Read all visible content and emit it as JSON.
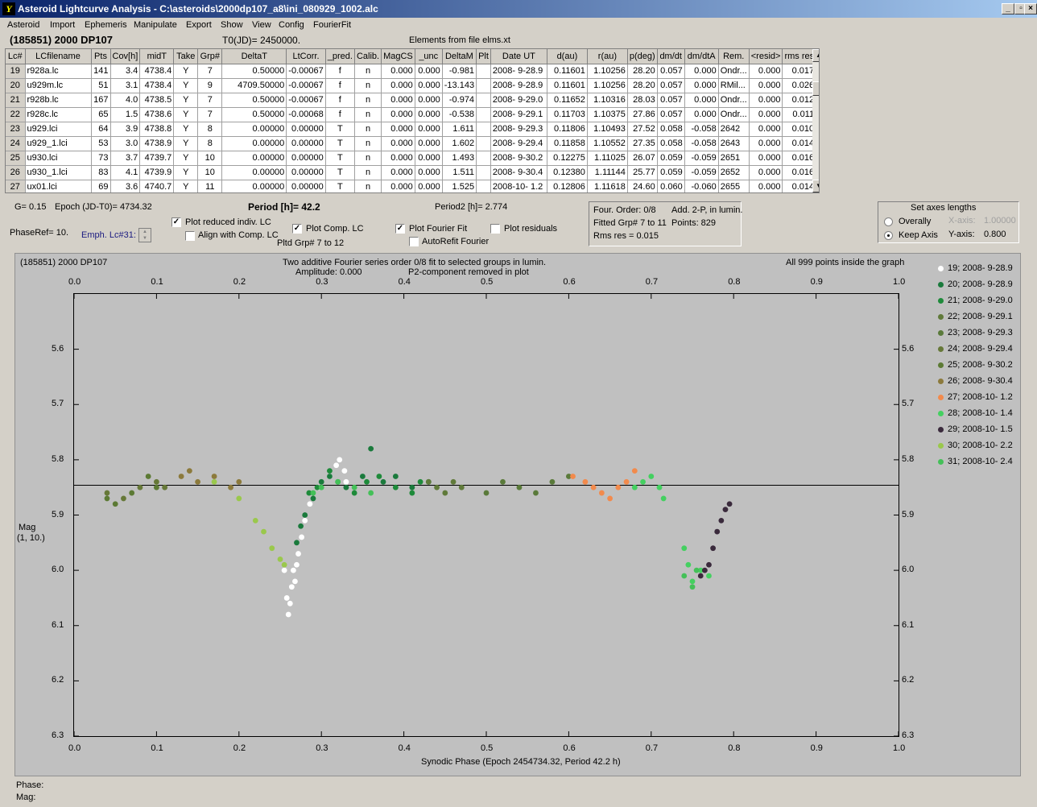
{
  "window": {
    "title": "Asteroid Lightcurve Analysis - C:\\asteroids\\2000dp107_a8\\ini_080929_1002.alc",
    "icon": "app-icon",
    "btn_min": "_",
    "btn_max": "▫",
    "btn_close": "×"
  },
  "menu": [
    "Asteroid",
    "Import",
    "Ephemeris",
    "Manipulate",
    "Export",
    "Show",
    "View",
    "Config",
    "FourierFit"
  ],
  "header": {
    "name": "(185851) 2000 DP107",
    "t0": "T0(JD)= 2450000.",
    "elements": "Elements from file elms.xt"
  },
  "table": {
    "columns": [
      "Lc#",
      "LCfilename",
      "Pts",
      "Cov[h]",
      "midT",
      "Take",
      "Grp#",
      "DeltaT",
      "LtCorr.",
      "_pred.",
      "Calib.",
      "MagCS",
      "_unc",
      "DeltaM",
      "Plt",
      "Date UT",
      "d(au)",
      "r(au)",
      "p(deg)",
      "dm/dt",
      "dm/dtA",
      "Rem.",
      "<resid>",
      "rms res"
    ],
    "rows": [
      [
        "19",
        "r928a.lc",
        "141",
        "3.4",
        "4738.4",
        "Y",
        "7",
        "0.50000",
        "-0.00067",
        "f",
        "n",
        "0.000",
        "0.000",
        "-0.981",
        "",
        "2008- 9-28.9",
        "0.11601",
        "1.10256",
        "28.20",
        "0.057",
        "0.000",
        "Ondr...",
        "0.000",
        "0.017"
      ],
      [
        "20",
        "u929m.lc",
        "51",
        "3.1",
        "4738.4",
        "Y",
        "9",
        "4709.50000",
        "-0.00067",
        "f",
        "n",
        "0.000",
        "0.000",
        "-13.143",
        "",
        "2008- 9-28.9",
        "0.11601",
        "1.10256",
        "28.20",
        "0.057",
        "0.000",
        "RMil...",
        "0.000",
        "0.026"
      ],
      [
        "21",
        "r928b.lc",
        "167",
        "4.0",
        "4738.5",
        "Y",
        "7",
        "0.50000",
        "-0.00067",
        "f",
        "n",
        "0.000",
        "0.000",
        "-0.974",
        "",
        "2008- 9-29.0",
        "0.11652",
        "1.10316",
        "28.03",
        "0.057",
        "0.000",
        "Ondr...",
        "0.000",
        "0.012"
      ],
      [
        "22",
        "r928c.lc",
        "65",
        "1.5",
        "4738.6",
        "Y",
        "7",
        "0.50000",
        "-0.00068",
        "f",
        "n",
        "0.000",
        "0.000",
        "-0.538",
        "",
        "2008- 9-29.1",
        "0.11703",
        "1.10375",
        "27.86",
        "0.057",
        "0.000",
        "Ondr...",
        "0.000",
        "0.011"
      ],
      [
        "23",
        "u929.lci",
        "64",
        "3.9",
        "4738.8",
        "Y",
        "8",
        "0.00000",
        "0.00000",
        "T",
        "n",
        "0.000",
        "0.000",
        "1.611",
        "",
        "2008- 9-29.3",
        "0.11806",
        "1.10493",
        "27.52",
        "0.058",
        "-0.058",
        "2642",
        "0.000",
        "0.010"
      ],
      [
        "24",
        "u929_1.lci",
        "53",
        "3.0",
        "4738.9",
        "Y",
        "8",
        "0.00000",
        "0.00000",
        "T",
        "n",
        "0.000",
        "0.000",
        "1.602",
        "",
        "2008- 9-29.4",
        "0.11858",
        "1.10552",
        "27.35",
        "0.058",
        "-0.058",
        "2643",
        "0.000",
        "0.014"
      ],
      [
        "25",
        "u930.lci",
        "73",
        "3.7",
        "4739.7",
        "Y",
        "10",
        "0.00000",
        "0.00000",
        "T",
        "n",
        "0.000",
        "0.000",
        "1.493",
        "",
        "2008- 9-30.2",
        "0.12275",
        "1.11025",
        "26.07",
        "0.059",
        "-0.059",
        "2651",
        "0.000",
        "0.016"
      ],
      [
        "26",
        "u930_1.lci",
        "83",
        "4.1",
        "4739.9",
        "Y",
        "10",
        "0.00000",
        "0.00000",
        "T",
        "n",
        "0.000",
        "0.000",
        "1.511",
        "",
        "2008- 9-30.4",
        "0.12380",
        "1.11144",
        "25.77",
        "0.059",
        "-0.059",
        "2652",
        "0.000",
        "0.016"
      ],
      [
        "27",
        "ux01.lci",
        "69",
        "3.6",
        "4740.7",
        "Y",
        "11",
        "0.00000",
        "0.00000",
        "T",
        "n",
        "0.000",
        "0.000",
        "1.525",
        "",
        "2008-10- 1.2",
        "0.12806",
        "1.11618",
        "24.60",
        "0.060",
        "-0.060",
        "2655",
        "0.000",
        "0.014"
      ]
    ]
  },
  "controls": {
    "g": "G= 0.15",
    "epoch": "Epoch (JD-T0)= 4734.32",
    "period": "Period [h]= 42.2",
    "period2": "Period2 [h]= 2.774",
    "phaseref": "PhaseRef= 10.",
    "emph": "Emph. Lc#31:",
    "plot_reduced": "Plot reduced indiv. LC",
    "align_comp": "Align with Comp. LC",
    "plot_comp": "Plot Comp. LC",
    "pltd_grp": "Pltd Grp#  7   to   12",
    "plot_fourier": "Plot Fourier Fit",
    "autorefit": "AutoRefit Fourier",
    "plot_residuals": "Plot residuals"
  },
  "fourier_info": {
    "order": "Four. Order:  0/8",
    "add": "Add. 2-P, in lumin.",
    "fitted": "Fitted Grp# 7 to 11",
    "points": "Points: 829",
    "rms": "Rms res      = 0.015"
  },
  "axes_box": {
    "title": "Set axes lengths",
    "overally": "Overally",
    "keep": "Keep Axis",
    "xaxis_label": "X-axis:",
    "xaxis_val": "1.00000",
    "yaxis_label": "Y-axis:",
    "yaxis_val": "0.800"
  },
  "plot": {
    "object": "(185851) 2000 DP107",
    "title1": "Two additive Fourier series order 0/8 fit to selected groups in lumin.",
    "title2": "Amplitude: 0.000",
    "title3": "P2-component removed in plot",
    "inside": "All 999 points inside the graph",
    "ylabel1": "Mag",
    "ylabel2": "(1, 10.)",
    "xlabel": "Synodic Phase (Epoch 2454734.32, Period 42.2 h)"
  },
  "chart_data": {
    "type": "scatter",
    "xlabel": "Synodic Phase (Epoch 2454734.32, Period 42.2 h)",
    "ylabel": "Mag",
    "xlim": [
      0,
      1
    ],
    "ylim": [
      6.3,
      5.5
    ],
    "y_inverted": true,
    "fit_line": 5.846,
    "x_ticks": [
      "0.0",
      "0.1",
      "0.2",
      "0.3",
      "0.4",
      "0.5",
      "0.6",
      "0.7",
      "0.8",
      "0.9",
      "1.0"
    ],
    "y_ticks": [
      "5.6",
      "5.7",
      "5.8",
      "5.9",
      "6.0",
      "6.1",
      "6.2",
      "6.3"
    ],
    "series": [
      {
        "name": "19; 2008- 9-28.9",
        "color": "#ffffff",
        "points": [
          [
            0.255,
            6.0
          ],
          [
            0.258,
            6.05
          ],
          [
            0.26,
            6.08
          ],
          [
            0.262,
            6.06
          ],
          [
            0.264,
            6.03
          ],
          [
            0.266,
            6.0
          ],
          [
            0.268,
            6.02
          ],
          [
            0.27,
            5.99
          ],
          [
            0.272,
            5.97
          ],
          [
            0.276,
            5.94
          ],
          [
            0.28,
            5.91
          ],
          [
            0.286,
            5.88
          ],
          [
            0.296,
            5.85
          ],
          [
            0.31,
            5.83
          ],
          [
            0.318,
            5.81
          ],
          [
            0.322,
            5.8
          ],
          [
            0.328,
            5.82
          ],
          [
            0.33,
            5.84
          ]
        ]
      },
      {
        "name": "20; 2008- 9-28.9",
        "color": "#1a7a3c",
        "points": [
          [
            0.27,
            5.95
          ],
          [
            0.275,
            5.92
          ],
          [
            0.28,
            5.9
          ],
          [
            0.29,
            5.87
          ],
          [
            0.3,
            5.84
          ],
          [
            0.31,
            5.83
          ],
          [
            0.33,
            5.85
          ],
          [
            0.35,
            5.83
          ],
          [
            0.36,
            5.78
          ],
          [
            0.375,
            5.84
          ],
          [
            0.39,
            5.83
          ],
          [
            0.41,
            5.85
          ],
          [
            0.43,
            5.84
          ]
        ]
      },
      {
        "name": "21; 2008- 9-29.0",
        "color": "#1e8a3a",
        "points": [
          [
            0.285,
            5.86
          ],
          [
            0.295,
            5.85
          ],
          [
            0.31,
            5.82
          ],
          [
            0.32,
            5.84
          ],
          [
            0.34,
            5.86
          ],
          [
            0.355,
            5.84
          ],
          [
            0.37,
            5.83
          ],
          [
            0.39,
            5.85
          ],
          [
            0.41,
            5.86
          ],
          [
            0.42,
            5.84
          ]
        ]
      },
      {
        "name": "22; 2008- 9-29.1",
        "color": "#607a3a",
        "points": [
          [
            0.43,
            5.84
          ],
          [
            0.44,
            5.85
          ],
          [
            0.45,
            5.86
          ],
          [
            0.46,
            5.84
          ],
          [
            0.47,
            5.85
          ]
        ]
      },
      {
        "name": "23; 2008- 9-29.3",
        "color": "#5a7a3a",
        "points": [
          [
            0.5,
            5.86
          ],
          [
            0.52,
            5.84
          ],
          [
            0.54,
            5.85
          ],
          [
            0.56,
            5.86
          ],
          [
            0.58,
            5.84
          ],
          [
            0.6,
            5.83
          ]
        ]
      },
      {
        "name": "24; 2008- 9-29.4",
        "color": "#667838",
        "points": [
          [
            0.04,
            5.86
          ],
          [
            0.06,
            5.87
          ],
          [
            0.08,
            5.85
          ],
          [
            0.1,
            5.84
          ],
          [
            0.11,
            5.85
          ]
        ]
      },
      {
        "name": "25; 2008- 9-30.2",
        "color": "#5c7a34",
        "points": [
          [
            0.04,
            5.87
          ],
          [
            0.05,
            5.88
          ],
          [
            0.07,
            5.86
          ],
          [
            0.09,
            5.83
          ],
          [
            0.1,
            5.85
          ]
        ]
      },
      {
        "name": "26; 2008- 9-30.4",
        "color": "#8c7a3c",
        "points": [
          [
            0.13,
            5.83
          ],
          [
            0.14,
            5.82
          ],
          [
            0.15,
            5.84
          ],
          [
            0.17,
            5.83
          ],
          [
            0.19,
            5.85
          ],
          [
            0.2,
            5.84
          ]
        ]
      },
      {
        "name": "27; 2008-10- 1.2",
        "color": "#f28a4c",
        "points": [
          [
            0.605,
            5.83
          ],
          [
            0.62,
            5.84
          ],
          [
            0.63,
            5.85
          ],
          [
            0.64,
            5.86
          ],
          [
            0.65,
            5.87
          ],
          [
            0.66,
            5.85
          ],
          [
            0.67,
            5.84
          ],
          [
            0.68,
            5.82
          ]
        ]
      },
      {
        "name": "28; 2008-10- 1.4",
        "color": "#44d060",
        "points": [
          [
            0.68,
            5.85
          ],
          [
            0.69,
            5.84
          ],
          [
            0.7,
            5.83
          ],
          [
            0.71,
            5.85
          ],
          [
            0.715,
            5.87
          ],
          [
            0.74,
            5.96
          ],
          [
            0.745,
            5.99
          ],
          [
            0.75,
            6.02
          ],
          [
            0.76,
            6.0
          ],
          [
            0.77,
            6.01
          ]
        ]
      },
      {
        "name": "29; 2008-10- 1.5",
        "color": "#3a2a3c",
        "points": [
          [
            0.76,
            6.01
          ],
          [
            0.765,
            6.0
          ],
          [
            0.77,
            5.99
          ],
          [
            0.775,
            5.96
          ],
          [
            0.78,
            5.93
          ],
          [
            0.785,
            5.91
          ],
          [
            0.79,
            5.89
          ],
          [
            0.795,
            5.88
          ]
        ]
      },
      {
        "name": "30; 2008-10- 2.2",
        "color": "#9ac84c",
        "points": [
          [
            0.17,
            5.84
          ],
          [
            0.2,
            5.87
          ],
          [
            0.22,
            5.91
          ],
          [
            0.23,
            5.93
          ],
          [
            0.24,
            5.96
          ],
          [
            0.25,
            5.98
          ],
          [
            0.255,
            5.99
          ]
        ]
      },
      {
        "name": "31; 2008-10- 2.4",
        "color": "#44c058",
        "points": [
          [
            0.29,
            5.86
          ],
          [
            0.3,
            5.85
          ],
          [
            0.32,
            5.84
          ],
          [
            0.34,
            5.85
          ],
          [
            0.36,
            5.86
          ],
          [
            0.74,
            6.01
          ],
          [
            0.75,
            6.03
          ],
          [
            0.755,
            6.0
          ]
        ]
      }
    ]
  },
  "status": {
    "phase": "Phase:",
    "mag": "Mag:"
  }
}
